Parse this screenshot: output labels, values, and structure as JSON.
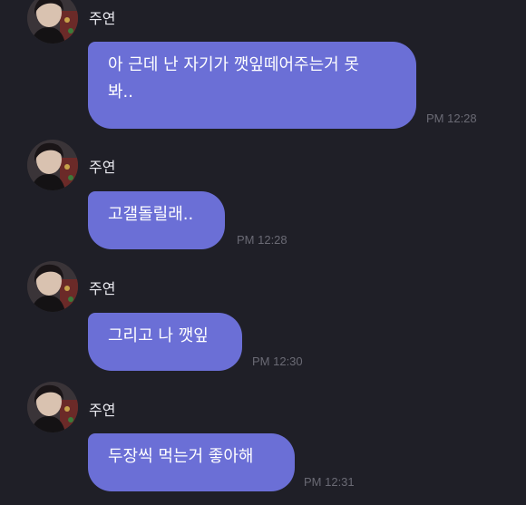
{
  "colors": {
    "background": "#1f1f27",
    "bubble": "#6b6fd6",
    "name_text": "#e9e9ef",
    "timestamp_text": "#6a6a74"
  },
  "messages": [
    {
      "sender": "주연",
      "avatar_icon": "profile-photo",
      "text": "아 근데 난 자기가 깻잎떼어주는거 못\n봐..",
      "time": "PM 12:28"
    },
    {
      "sender": "주연",
      "avatar_icon": "profile-photo",
      "text": "고갤돌릴래..",
      "time": "PM 12:28"
    },
    {
      "sender": "주연",
      "avatar_icon": "profile-photo",
      "text": "그리고 나 깻잎",
      "time": "PM 12:30"
    },
    {
      "sender": "주연",
      "avatar_icon": "profile-photo",
      "text": "두장씩 먹는거 좋아해",
      "time": "PM 12:31"
    }
  ]
}
